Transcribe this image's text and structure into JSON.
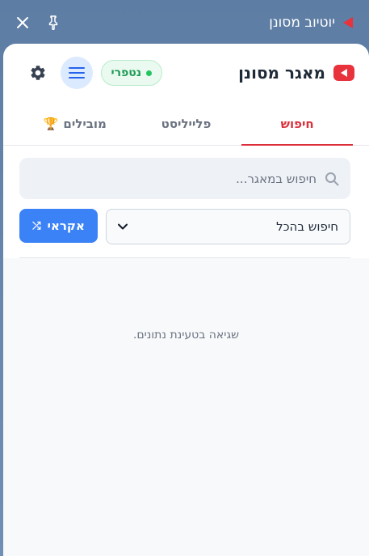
{
  "window": {
    "title": "יוטיוב מסונן"
  },
  "header": {
    "app_name": "מאגר מסונן",
    "status_label": "נטפרי"
  },
  "tabs": [
    {
      "label": "חיפוש",
      "active": true
    },
    {
      "label": "פלייליסט",
      "active": false
    },
    {
      "label": "מובילים",
      "active": false,
      "icon": "trophy-icon"
    }
  ],
  "search": {
    "placeholder": "חיפוש במאגר...",
    "value": ""
  },
  "filter": {
    "selected": "חיפוש בהכל"
  },
  "random_button": {
    "label": "אקראי",
    "icon": "shuffle-icon"
  },
  "content": {
    "error_message": "שגיאה בטעינת נתונים."
  },
  "colors": {
    "accent_red": "#dc2f3a",
    "primary_blue": "#3b82f6",
    "status_green": "#1d9a55"
  }
}
